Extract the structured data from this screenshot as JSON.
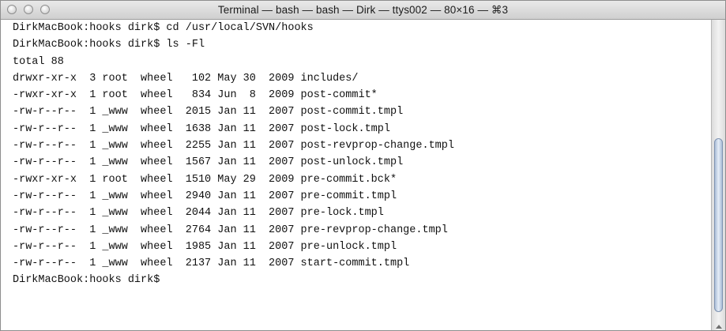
{
  "window": {
    "title": "Terminal — bash — bash — Dirk — ttys002 — 80×16 — ⌘3"
  },
  "terminal": {
    "lines": [
      "DirkMacBook:hooks dirk$ cd /usr/local/SVN/hooks",
      "DirkMacBook:hooks dirk$ ls -Fl",
      "total 88",
      "drwxr-xr-x  3 root  wheel   102 May 30  2009 includes/",
      "-rwxr-xr-x  1 root  wheel   834 Jun  8  2009 post-commit*",
      "-rw-r--r--  1 _www  wheel  2015 Jan 11  2007 post-commit.tmpl",
      "-rw-r--r--  1 _www  wheel  1638 Jan 11  2007 post-lock.tmpl",
      "-rw-r--r--  1 _www  wheel  2255 Jan 11  2007 post-revprop-change.tmpl",
      "-rw-r--r--  1 _www  wheel  1567 Jan 11  2007 post-unlock.tmpl",
      "-rwxr-xr-x  1 root  wheel  1510 May 29  2009 pre-commit.bck*",
      "-rw-r--r--  1 _www  wheel  2940 Jan 11  2007 pre-commit.tmpl",
      "-rw-r--r--  1 _www  wheel  2044 Jan 11  2007 pre-lock.tmpl",
      "-rw-r--r--  1 _www  wheel  2764 Jan 11  2007 pre-revprop-change.tmpl",
      "-rw-r--r--  1 _www  wheel  1985 Jan 11  2007 pre-unlock.tmpl",
      "-rw-r--r--  1 _www  wheel  2137 Jan 11  2007 start-commit.tmpl",
      "DirkMacBook:hooks dirk$ "
    ]
  },
  "colors": {
    "terminal_background": "#ffffff",
    "terminal_text": "#111111",
    "titlebar": "#d9d9d9"
  },
  "icons": {
    "close": "close-icon",
    "minimize": "minimize-icon",
    "zoom": "zoom-icon"
  }
}
